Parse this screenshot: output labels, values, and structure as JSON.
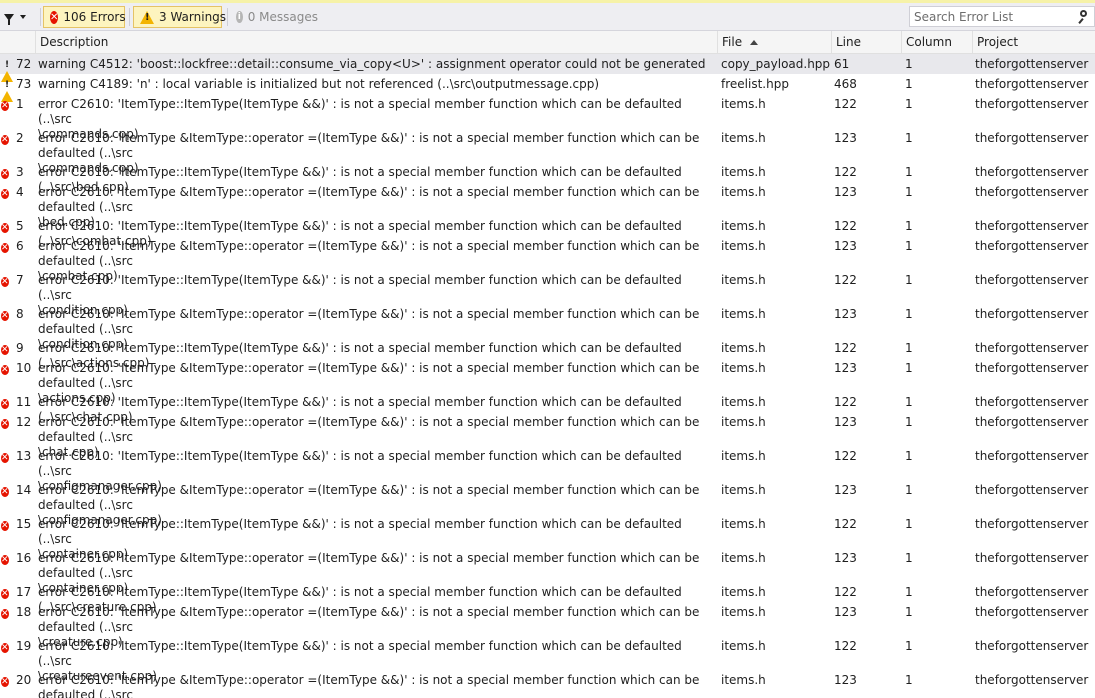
{
  "toolbar": {
    "errors_label": "106 Errors",
    "warnings_label": "3 Warnings",
    "messages_label": "0 Messages",
    "search_placeholder": "Search Error List"
  },
  "columns": {
    "description": "Description",
    "file": "File",
    "line": "Line",
    "column": "Column",
    "project": "Project"
  },
  "rows": [
    {
      "type": "warning",
      "num": "72",
      "desc": "warning C4512: 'boost::lockfree::detail::consume_via_copy<U>' : assignment operator could not be generated",
      "file": "copy_payload.hpp",
      "line": "61",
      "col": "1",
      "project": "theforgottenserver"
    },
    {
      "type": "warning",
      "num": "73",
      "desc": "warning C4189: 'n' : local variable is initialized but not referenced (..\\src\\outputmessage.cpp)",
      "file": "freelist.hpp",
      "line": "468",
      "col": "1",
      "project": "theforgottenserver"
    },
    {
      "type": "error",
      "num": "1",
      "desc": "error C2610: 'ItemType::ItemType(ItemType &&)' : is not a special member function which can be defaulted (..\\src\n\\commands.cpp)",
      "file": "items.h",
      "line": "122",
      "col": "1",
      "project": "theforgottenserver"
    },
    {
      "type": "error",
      "num": "2",
      "desc": "error C2610: 'ItemType &ItemType::operator =(ItemType &&)' : is not a special member function which can be defaulted (..\\src\n\\commands.cpp)",
      "file": "items.h",
      "line": "123",
      "col": "1",
      "project": "theforgottenserver"
    },
    {
      "type": "error",
      "num": "3",
      "desc": "error C2610: 'ItemType::ItemType(ItemType &&)' : is not a special member function which can be defaulted (..\\src\\bed.cpp)",
      "file": "items.h",
      "line": "122",
      "col": "1",
      "project": "theforgottenserver"
    },
    {
      "type": "error",
      "num": "4",
      "desc": "error C2610: 'ItemType &ItemType::operator =(ItemType &&)' : is not a special member function which can be defaulted (..\\src\n\\bed.cpp)",
      "file": "items.h",
      "line": "123",
      "col": "1",
      "project": "theforgottenserver"
    },
    {
      "type": "error",
      "num": "5",
      "desc": "error C2610: 'ItemType::ItemType(ItemType &&)' : is not a special member function which can be defaulted (..\\src\\combat.cpp)",
      "file": "items.h",
      "line": "122",
      "col": "1",
      "project": "theforgottenserver"
    },
    {
      "type": "error",
      "num": "6",
      "desc": "error C2610: 'ItemType &ItemType::operator =(ItemType &&)' : is not a special member function which can be defaulted (..\\src\n\\combat.cpp)",
      "file": "items.h",
      "line": "123",
      "col": "1",
      "project": "theforgottenserver"
    },
    {
      "type": "error",
      "num": "7",
      "desc": "error C2610: 'ItemType::ItemType(ItemType &&)' : is not a special member function which can be defaulted (..\\src\n\\condition.cpp)",
      "file": "items.h",
      "line": "122",
      "col": "1",
      "project": "theforgottenserver"
    },
    {
      "type": "error",
      "num": "8",
      "desc": "error C2610: 'ItemType &ItemType::operator =(ItemType &&)' : is not a special member function which can be defaulted (..\\src\n\\condition.cpp)",
      "file": "items.h",
      "line": "123",
      "col": "1",
      "project": "theforgottenserver"
    },
    {
      "type": "error",
      "num": "9",
      "desc": "error C2610: 'ItemType::ItemType(ItemType &&)' : is not a special member function which can be defaulted (..\\src\\actions.cpp)",
      "file": "items.h",
      "line": "122",
      "col": "1",
      "project": "theforgottenserver"
    },
    {
      "type": "error",
      "num": "10",
      "desc": "error C2610: 'ItemType &ItemType::operator =(ItemType &&)' : is not a special member function which can be defaulted (..\\src\n\\actions.cpp)",
      "file": "items.h",
      "line": "123",
      "col": "1",
      "project": "theforgottenserver"
    },
    {
      "type": "error",
      "num": "11",
      "desc": "error C2610: 'ItemType::ItemType(ItemType &&)' : is not a special member function which can be defaulted (..\\src\\chat.cpp)",
      "file": "items.h",
      "line": "122",
      "col": "1",
      "project": "theforgottenserver"
    },
    {
      "type": "error",
      "num": "12",
      "desc": "error C2610: 'ItemType &ItemType::operator =(ItemType &&)' : is not a special member function which can be defaulted (..\\src\n\\chat.cpp)",
      "file": "items.h",
      "line": "123",
      "col": "1",
      "project": "theforgottenserver"
    },
    {
      "type": "error",
      "num": "13",
      "desc": "error C2610: 'ItemType::ItemType(ItemType &&)' : is not a special member function which can be defaulted (..\\src\n\\configmanager.cpp)",
      "file": "items.h",
      "line": "122",
      "col": "1",
      "project": "theforgottenserver"
    },
    {
      "type": "error",
      "num": "14",
      "desc": "error C2610: 'ItemType &ItemType::operator =(ItemType &&)' : is not a special member function which can be defaulted (..\\src\n\\configmanager.cpp)",
      "file": "items.h",
      "line": "123",
      "col": "1",
      "project": "theforgottenserver"
    },
    {
      "type": "error",
      "num": "15",
      "desc": "error C2610: 'ItemType::ItemType(ItemType &&)' : is not a special member function which can be defaulted (..\\src\n\\container.cpp)",
      "file": "items.h",
      "line": "122",
      "col": "1",
      "project": "theforgottenserver"
    },
    {
      "type": "error",
      "num": "16",
      "desc": "error C2610: 'ItemType &ItemType::operator =(ItemType &&)' : is not a special member function which can be defaulted (..\\src\n\\container.cpp)",
      "file": "items.h",
      "line": "123",
      "col": "1",
      "project": "theforgottenserver"
    },
    {
      "type": "error",
      "num": "17",
      "desc": "error C2610: 'ItemType::ItemType(ItemType &&)' : is not a special member function which can be defaulted (..\\src\\creature.cpp)",
      "file": "items.h",
      "line": "122",
      "col": "1",
      "project": "theforgottenserver"
    },
    {
      "type": "error",
      "num": "18",
      "desc": "error C2610: 'ItemType &ItemType::operator =(ItemType &&)' : is not a special member function which can be defaulted (..\\src\n\\creature.cpp)",
      "file": "items.h",
      "line": "123",
      "col": "1",
      "project": "theforgottenserver"
    },
    {
      "type": "error",
      "num": "19",
      "desc": "error C2610: 'ItemType::ItemType(ItemType &&)' : is not a special member function which can be defaulted (..\\src\n\\creatureevent.cpp)",
      "file": "items.h",
      "line": "122",
      "col": "1",
      "project": "theforgottenserver"
    },
    {
      "type": "error",
      "num": "20",
      "desc": "error C2610: 'ItemType &ItemType::operator =(ItemType &&)' : is not a special member function which can be defaulted (..\\src\n\\creatureevent.cpp)",
      "file": "items.h",
      "line": "123",
      "col": "1",
      "project": "theforgottenserver"
    }
  ]
}
